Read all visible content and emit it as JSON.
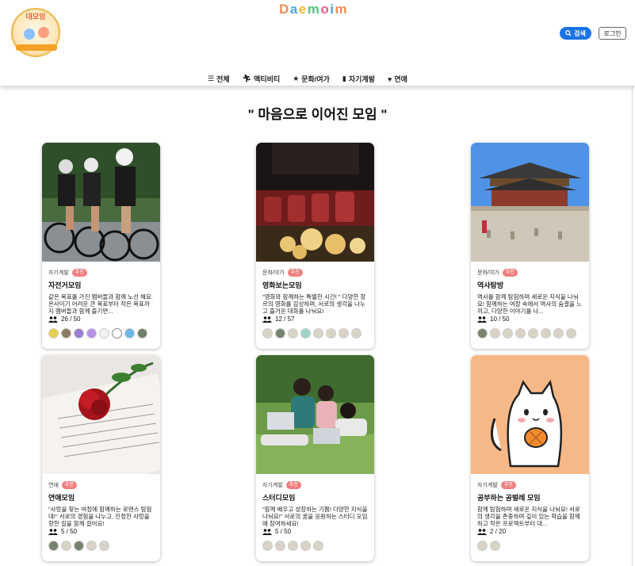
{
  "header": {
    "logo_text": "대모임",
    "brand_letters": [
      "D",
      "a",
      "e",
      "m",
      "o",
      "i",
      "m"
    ],
    "brand_colors": [
      "#f28a5b",
      "#4aa3df",
      "#f7b733",
      "#58c27d",
      "#e85a8e",
      "#4aa3df",
      "#f28a5b"
    ],
    "search_label": "검색",
    "login_label": "로그인"
  },
  "nav": {
    "items": [
      {
        "label": "전체",
        "icon": "list-icon"
      },
      {
        "label": "액티비티",
        "icon": "running-icon"
      },
      {
        "label": "문화/여가",
        "icon": "star-icon"
      },
      {
        "label": "자기계발",
        "icon": "book-icon"
      },
      {
        "label": "연애",
        "icon": "heart-icon"
      }
    ]
  },
  "section": {
    "title": "\" 마음으로 이어진 모임 \""
  },
  "cards": [
    {
      "category": "자기계발",
      "badge": "추천",
      "title": "자전거모임",
      "desc": "같은 목표를 가진 멤버들과 함께 노선 해요. 온사이기 어려운 큰 목표부터 작은 목표까지 멤버들과 함께 즐기면...",
      "count": "26 / 50"
    },
    {
      "category": "문화/여가",
      "badge": "추천",
      "title": "영화보는모임",
      "desc": "\"영화와 함께하는 특별한 시간! \" 다양한 장르의 영화를 감상하며, 서로의 생각을 나누고 즐거운 대화를 나눠요!",
      "count": "12 / 57"
    },
    {
      "category": "문화/여가",
      "badge": "추천",
      "title": "역사탐방",
      "desc": "역사를 함께 탐험하며 새로운 지식을 나눠요! 함께하는 여정 속에서 역사의 숨결을 느끼고, 다양한 이야기를 나...",
      "count": "10 / 50"
    },
    {
      "category": "연애",
      "badge": "추천",
      "title": "연애모임",
      "desc": "\"사랑을 찾는 여정에 함께하는 로맨스 탐험대!\" 서로의 경험을 나누고, 진정한 사랑을 향한 길을 함께 걸어요!",
      "count": "5 / 50"
    },
    {
      "category": "자기계발",
      "badge": "추천",
      "title": "스터디모임",
      "desc": "\"함께 배우고 성장하는 기쁨! 다양한 지식을 나눠요!\" 서로의 꿈을 응원하는 스터디 모임에 참여하세요!",
      "count": "5 / 50"
    },
    {
      "category": "자기계발",
      "badge": "추천",
      "title": "공부하는 공벌레 모임",
      "desc": "함께 탐험하며 새로운 지식을 나눠요! 서로의 생각을 존중하며 깊이 있는 학습을 함께 하고 작은 프로젝트부터 대...",
      "count": "2 / 20"
    }
  ]
}
